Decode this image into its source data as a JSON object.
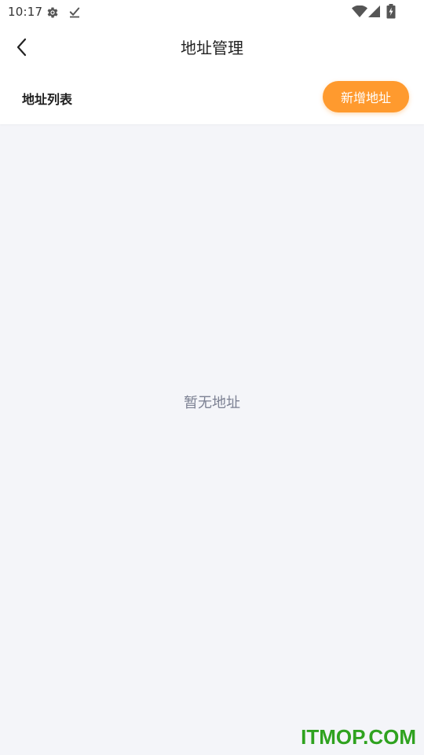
{
  "status_bar": {
    "time": "10:17",
    "icons": [
      "gear-icon",
      "download-done-icon",
      "wifi-icon",
      "signal-icon",
      "battery-charging-icon"
    ]
  },
  "nav": {
    "back_icon": "chevron-left-icon",
    "title": "地址管理"
  },
  "section": {
    "title": "地址列表",
    "add_button_label": "新增地址"
  },
  "empty_state": {
    "message": "暂无地址"
  },
  "watermark": {
    "text": "ITMOP.COM"
  },
  "colors": {
    "accent": "#ff9a2e",
    "page_background": "#f4f5f9",
    "header_background": "#ffffff",
    "empty_text": "#7c8193",
    "watermark": "#2fa21f"
  }
}
